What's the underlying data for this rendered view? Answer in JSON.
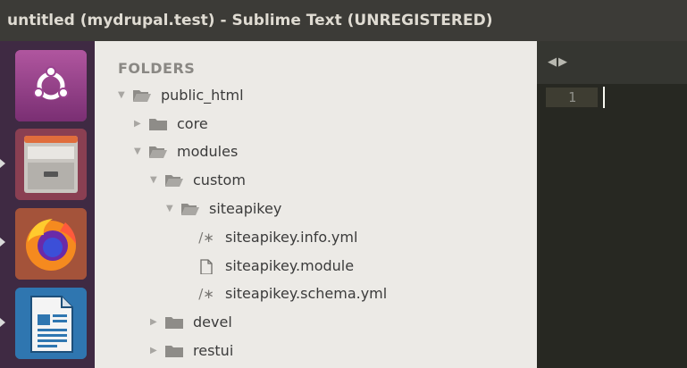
{
  "window": {
    "title": "untitled (mydrupal.test) - Sublime Text (UNREGISTERED)"
  },
  "launcher": {
    "items": [
      {
        "icon": "ubuntu-dash-icon"
      },
      {
        "icon": "file-manager-icon"
      },
      {
        "icon": "firefox-icon"
      },
      {
        "icon": "libreoffice-writer-icon"
      }
    ]
  },
  "sidebar": {
    "heading": "FOLDERS",
    "tree": [
      {
        "label": "public_html",
        "type": "folder",
        "expanded": true
      },
      {
        "label": "core",
        "type": "folder",
        "expanded": false
      },
      {
        "label": "modules",
        "type": "folder",
        "expanded": true
      },
      {
        "label": "custom",
        "type": "folder",
        "expanded": true
      },
      {
        "label": "siteapikey",
        "type": "folder",
        "expanded": true
      },
      {
        "label": "siteapikey.info.yml",
        "type": "file",
        "icon": "/∗"
      },
      {
        "label": "siteapikey.module",
        "type": "file",
        "icon": "page-icon"
      },
      {
        "label": "siteapikey.schema.yml",
        "type": "file",
        "icon": "/∗"
      },
      {
        "label": "devel",
        "type": "folder",
        "expanded": false
      },
      {
        "label": "restui",
        "type": "folder",
        "expanded": false
      }
    ]
  },
  "editor": {
    "nav_arrows": "◀▶",
    "line_numbers": [
      "1"
    ]
  },
  "colors": {
    "titlebar_bg": "#3c3b37",
    "launcher_bg": "#3f2a43",
    "sidebar_bg": "#eceae6",
    "editor_bg": "#272822"
  }
}
